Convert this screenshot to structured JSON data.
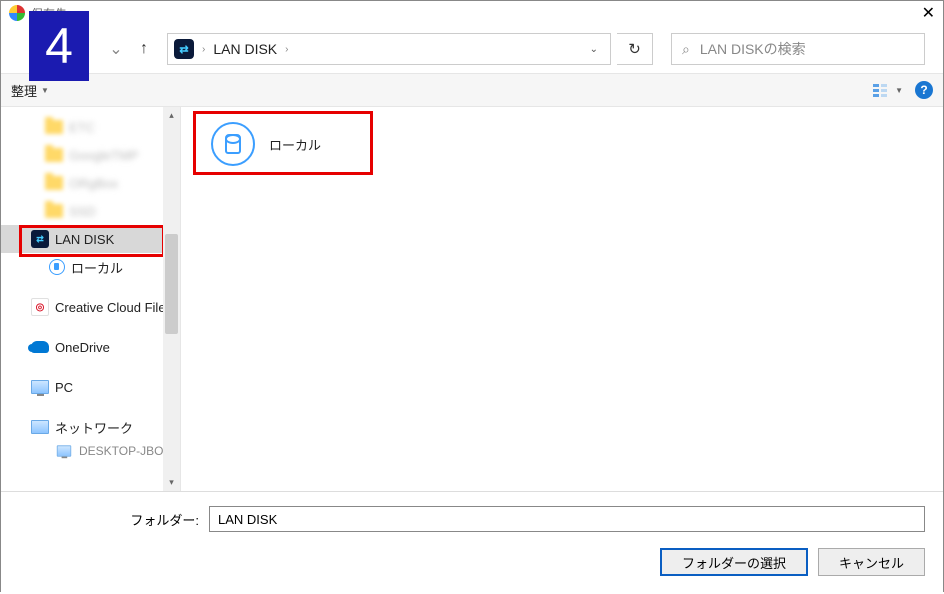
{
  "window": {
    "title": "保存先",
    "close": "✕"
  },
  "step_number": "4",
  "nav": {
    "back": "←",
    "forward": "→",
    "back_dd": "⌄",
    "up": "↑"
  },
  "address": {
    "location": "LAN DISK",
    "sep": "›",
    "dd": "⌄",
    "refresh": "↻"
  },
  "search": {
    "placeholder": "LAN DISKの検索"
  },
  "toolbar": {
    "organize": "整理",
    "dd": "▼",
    "help": "?"
  },
  "tree": {
    "blurred": [
      {
        "label": "ETC"
      },
      {
        "label": "GoogleTMP"
      },
      {
        "label": "ORgBox"
      },
      {
        "label": "SSD"
      }
    ],
    "lan_disk": "LAN DISK",
    "local": "ローカル",
    "cc": "Creative Cloud File",
    "onedrive": "OneDrive",
    "pc": "PC",
    "network": "ネットワーク",
    "desktop_cut": "DESKTOP-JBOTN"
  },
  "pane": {
    "item_label": "ローカル"
  },
  "footer": {
    "folder_label": "フォルダー:",
    "folder_value": "LAN DISK",
    "select": "フォルダーの選択",
    "cancel": "キャンセル"
  }
}
